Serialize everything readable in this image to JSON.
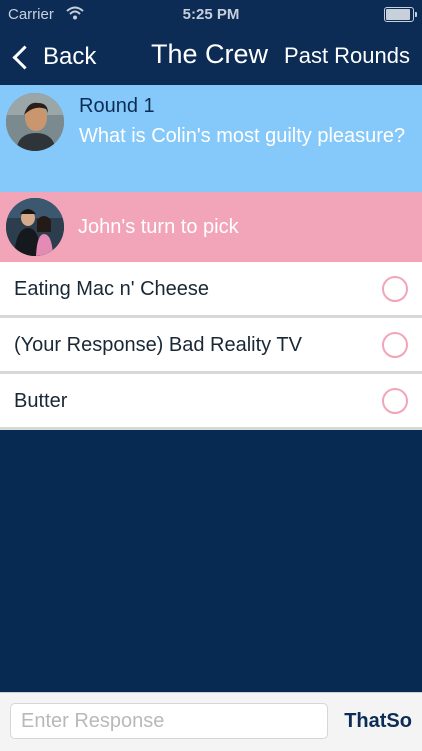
{
  "status_bar": {
    "carrier": "Carrier",
    "time": "5:25 PM"
  },
  "navbar": {
    "back_label": "Back",
    "title": "The Crew",
    "past_rounds_label": "Past Rounds"
  },
  "round": {
    "label": "Round 1",
    "question": "What is Colin's most guilty pleasure?"
  },
  "turn": {
    "text": "John's turn to pick"
  },
  "responses": [
    {
      "text": "Eating Mac n' Cheese"
    },
    {
      "text": "(Your Response) Bad Reality TV"
    },
    {
      "text": "Butter"
    }
  ],
  "input": {
    "placeholder": "Enter Response"
  },
  "send": {
    "label": "ThatSo"
  },
  "colors": {
    "navy": "#0c2c55",
    "background": "#062a52",
    "light_blue": "#85c9fa",
    "pink": "#f2a5b8"
  }
}
